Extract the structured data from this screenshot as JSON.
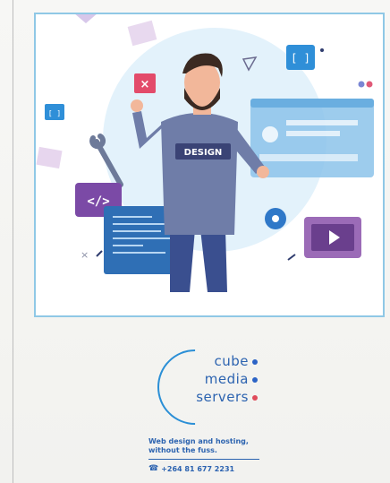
{
  "illustration": {
    "shirt_label": "DESIGN",
    "bracket_label": "[ ]",
    "small_bracket_label": "[ ]",
    "code_label": "</>"
  },
  "brand": {
    "line1": "cube",
    "line2": "media",
    "line3": "servers",
    "tagline": "Web design and hosting, without the fuss.",
    "phone": "+264 81 677 2231",
    "colors": {
      "text": "#2c63b0",
      "dot1": "#2b63c6",
      "dot2": "#2b63c6",
      "dot3": "#e04b5a",
      "arc": "#2b8fd6"
    }
  }
}
